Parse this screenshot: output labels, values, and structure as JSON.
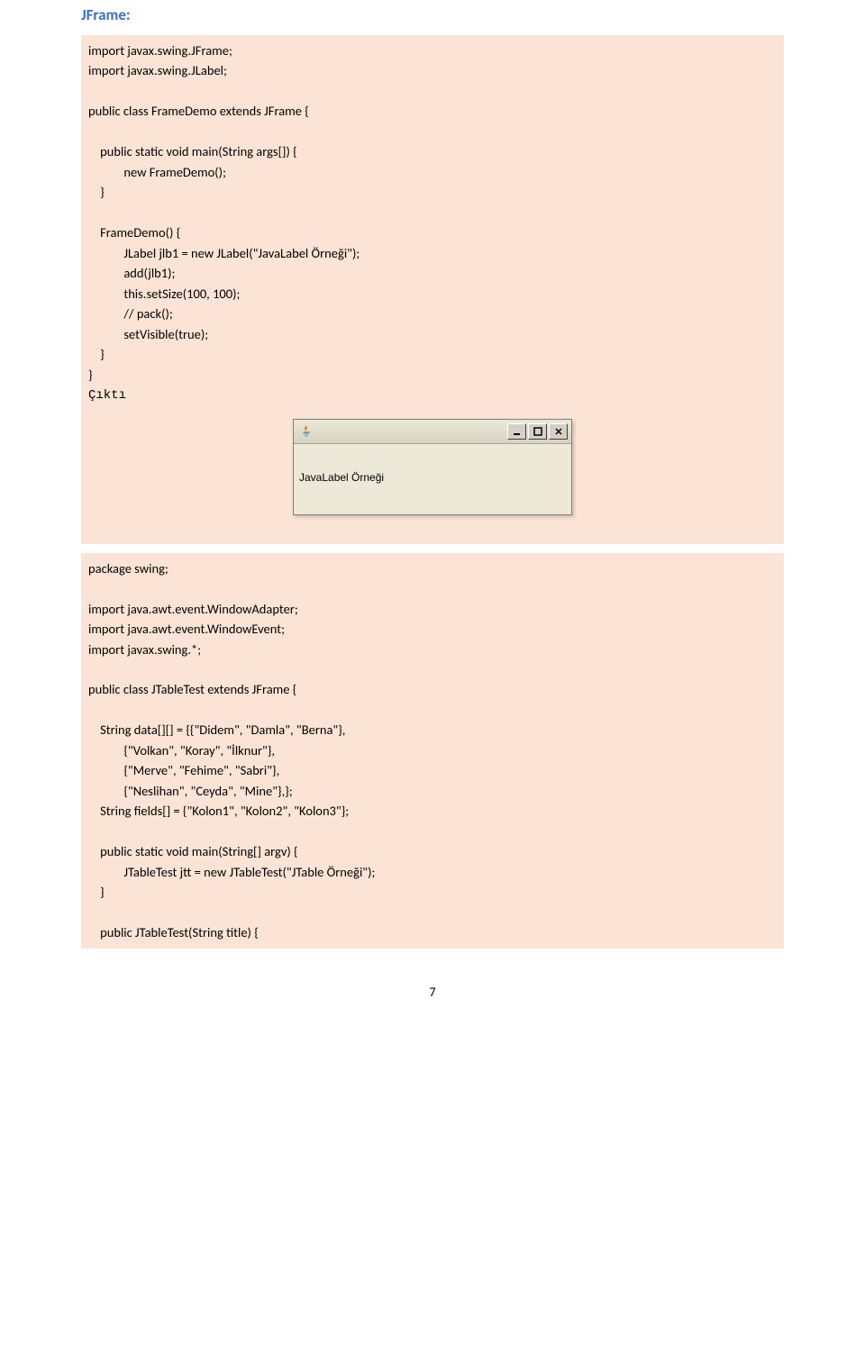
{
  "heading": "JFrame:",
  "block1": {
    "lines": [
      "import javax.swing.JFrame;",
      "import javax.swing.JLabel;",
      "",
      "public class FrameDemo extends JFrame {",
      "",
      "  public static void main(String args[]) {",
      "      new FrameDemo();",
      "  }",
      "",
      "  FrameDemo() {",
      "      JLabel jlb1 = new JLabel(\"JavaLabel Örneği\");",
      "      add(jlb1);",
      "      this.setSize(100, 100);",
      "      // pack();",
      "      setVisible(true);",
      "  }",
      "}"
    ],
    "output_label": "Çıktı"
  },
  "window": {
    "label_text": "JavaLabel Örneği"
  },
  "block2": {
    "lines": [
      "package swing;",
      "",
      "import java.awt.event.WindowAdapter;",
      "import java.awt.event.WindowEvent;",
      "import javax.swing.*;",
      "",
      "public class JTableTest extends JFrame {",
      "",
      "  String data[][] = {{\"Didem\", \"Damla\", \"Berna\"},",
      "      {\"Volkan\", \"Koray\", \"İlknur\"},",
      "      {\"Merve\", \"Fehime\", \"Sabri\"},",
      "      {\"Neslihan\", \"Ceyda\", \"Mine\"},};",
      "  String fields[] = {\"Kolon1\", \"Kolon2\", \"Kolon3\"};",
      "",
      "  public static void main(String[] argv) {",
      "      JTableTest jtt = new JTableTest(\"JTable Örneği\");",
      "  }",
      "",
      "  public JTableTest(String title) {"
    ]
  },
  "page_number": "7",
  "chart_data": {
    "type": "table",
    "title": "JTableTest data array",
    "columns": [
      "Kolon1",
      "Kolon2",
      "Kolon3"
    ],
    "rows": [
      [
        "Didem",
        "Damla",
        "Berna"
      ],
      [
        "Volkan",
        "Koray",
        "İlknur"
      ],
      [
        "Merve",
        "Fehime",
        "Sabri"
      ],
      [
        "Neslihan",
        "Ceyda",
        "Mine"
      ]
    ]
  }
}
